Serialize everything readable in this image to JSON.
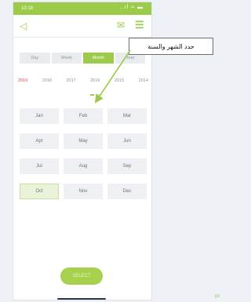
{
  "status": {
    "time": "10:18",
    "signal": "..ıl ≈ ▬"
  },
  "nav": {
    "back_icon": "◁",
    "mail_icon": "✉",
    "menu_icon": "☰"
  },
  "segments": [
    {
      "label": "Day",
      "active": false
    },
    {
      "label": "Week",
      "active": false
    },
    {
      "label": "Month",
      "active": true
    },
    {
      "label": "Year",
      "active": false
    }
  ],
  "years": [
    {
      "label": "2019",
      "selected": true
    },
    {
      "label": "2018",
      "selected": false
    },
    {
      "label": "2017",
      "selected": false
    },
    {
      "label": "2016",
      "selected": false
    },
    {
      "label": "2015",
      "selected": false
    },
    {
      "label": "2014",
      "selected": false
    }
  ],
  "months": [
    {
      "label": "Jan",
      "selected": false
    },
    {
      "label": "Feb",
      "selected": false
    },
    {
      "label": "Mar",
      "selected": false
    },
    {
      "label": "Apr",
      "selected": false
    },
    {
      "label": "May",
      "selected": false
    },
    {
      "label": "Jun",
      "selected": false
    },
    {
      "label": "Jul",
      "selected": false
    },
    {
      "label": "Aug",
      "selected": false
    },
    {
      "label": "Sep",
      "selected": false
    },
    {
      "label": "Oct",
      "selected": true
    },
    {
      "label": "Nov",
      "selected": false
    },
    {
      "label": "Dec",
      "selected": false
    }
  ],
  "select_button": "SELECT",
  "callout": {
    "text": "حدد الشهر والسنة"
  },
  "corner_mark": "px",
  "colors": {
    "accent": "#9bcb49",
    "selected_year": "#e04848"
  }
}
